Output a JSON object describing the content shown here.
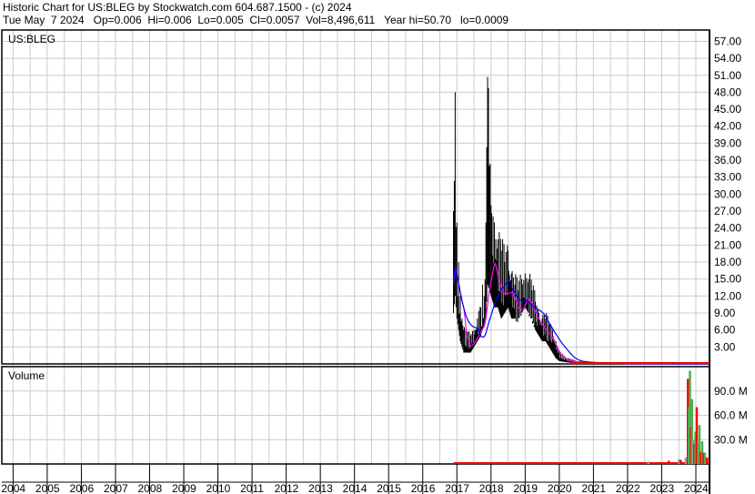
{
  "header": {
    "line1": "Historic Chart for US:BLEG by Stockwatch.com 604.687.1500 - (c) 2024",
    "line2": "Tue May  7 2024   Op=0.006  Hi=0.006  Lo=0.005  Cl=0.0057  Vol=8,496,611   Year hi=50.70   lo=0.0009"
  },
  "chart_data": [
    {
      "type": "line",
      "title": "US:BLEG",
      "ylim": [
        0,
        59
      ],
      "yticks": [
        "3.00",
        "6.00",
        "9.00",
        "12.00",
        "15.00",
        "18.00",
        "21.00",
        "24.00",
        "27.00",
        "30.00",
        "33.00",
        "36.00",
        "39.00",
        "42.00",
        "45.00",
        "48.00",
        "51.00",
        "54.00",
        "57.00"
      ],
      "xticks": [
        "2004",
        "2005",
        "2006",
        "2007",
        "2008",
        "2009",
        "2010",
        "2011",
        "2012",
        "2013",
        "2014",
        "2015",
        "2016",
        "2017",
        "2018",
        "2019",
        "2020",
        "2021",
        "2022",
        "2023",
        "2024"
      ],
      "xlim": [
        2003.67,
        2024.4
      ],
      "bars": [
        [
          2016.9,
          27,
          9,
          14
        ],
        [
          2016.95,
          48,
          12,
          20
        ],
        [
          2017.0,
          25,
          8,
          12
        ],
        [
          2017.05,
          18,
          6,
          10
        ],
        [
          2017.1,
          12,
          4,
          6
        ],
        [
          2017.15,
          8,
          3,
          4
        ],
        [
          2017.2,
          6,
          2,
          3
        ],
        [
          2017.3,
          5,
          2,
          3
        ],
        [
          2017.4,
          5,
          2,
          4
        ],
        [
          2017.5,
          6,
          3,
          5
        ],
        [
          2017.6,
          8,
          4,
          6
        ],
        [
          2017.7,
          10,
          5,
          7
        ],
        [
          2017.75,
          14,
          6,
          9
        ],
        [
          2017.8,
          12,
          7,
          8
        ],
        [
          2017.85,
          25,
          8,
          18
        ],
        [
          2017.9,
          50.7,
          14,
          22
        ],
        [
          2017.95,
          35,
          13,
          20
        ],
        [
          2018.0,
          28,
          12,
          17
        ],
        [
          2018.1,
          25,
          10,
          15
        ],
        [
          2018.2,
          22,
          10,
          13
        ],
        [
          2018.3,
          20,
          8,
          12
        ],
        [
          2018.4,
          18,
          9,
          13
        ],
        [
          2018.5,
          20,
          10,
          14
        ],
        [
          2018.6,
          16,
          8,
          11
        ],
        [
          2018.7,
          14,
          8,
          10
        ],
        [
          2018.8,
          13,
          8,
          10
        ],
        [
          2018.9,
          15,
          9,
          11
        ],
        [
          2019.0,
          16,
          10,
          13
        ],
        [
          2019.1,
          15,
          9,
          11
        ],
        [
          2019.2,
          13,
          8,
          10
        ],
        [
          2019.3,
          11,
          6,
          8
        ],
        [
          2019.4,
          9,
          5,
          7
        ],
        [
          2019.5,
          8,
          4,
          6
        ],
        [
          2019.6,
          8,
          4,
          6
        ],
        [
          2019.7,
          7,
          3,
          5
        ],
        [
          2019.8,
          6,
          2,
          3
        ],
        [
          2019.9,
          4,
          1,
          2
        ],
        [
          2020.0,
          2,
          0.5,
          1
        ],
        [
          2020.2,
          1,
          0.3,
          0.5
        ],
        [
          2020.5,
          0.5,
          0.2,
          0.3
        ],
        [
          2021.0,
          0.3,
          0.1,
          0.2
        ],
        [
          2021.5,
          0.2,
          0.05,
          0.1
        ],
        [
          2022.0,
          0.1,
          0.02,
          0.05
        ],
        [
          2023.0,
          0.05,
          0.01,
          0.02
        ],
        [
          2024.35,
          0.006,
          0.005,
          0.0057
        ]
      ],
      "series": [
        {
          "name": "MA short",
          "color": "#ff00ff",
          "period": 3
        },
        {
          "name": "MA long",
          "color": "#0000ff",
          "period": 8
        }
      ],
      "lastline_color": "#ff0000"
    },
    {
      "type": "bar",
      "title": "Volume",
      "ylim": [
        0,
        120
      ],
      "unit": "M",
      "yticks": [
        "30.0 M",
        "60.0 M",
        "90.0 M"
      ],
      "bars": [
        [
          2022.6,
          3,
          "#999999"
        ],
        [
          2022.7,
          2,
          "#ff0000"
        ],
        [
          2023.2,
          4,
          "#ff0000"
        ],
        [
          2023.5,
          6,
          "#999999"
        ],
        [
          2023.55,
          5,
          "#ff0000"
        ],
        [
          2023.7,
          8,
          "#999999"
        ],
        [
          2023.76,
          105,
          "#ff0000"
        ],
        [
          2023.79,
          70,
          "#4caf50"
        ],
        [
          2023.82,
          115,
          "#4caf50"
        ],
        [
          2023.85,
          45,
          "#ff0000"
        ],
        [
          2023.88,
          80,
          "#4caf50"
        ],
        [
          2023.91,
          30,
          "#999999"
        ],
        [
          2023.95,
          25,
          "#ff0000"
        ],
        [
          2023.98,
          40,
          "#4caf50"
        ],
        [
          2024.02,
          70,
          "#ff0000"
        ],
        [
          2024.06,
          25,
          "#4caf50"
        ],
        [
          2024.1,
          48,
          "#4caf50"
        ],
        [
          2024.14,
          15,
          "#ff0000"
        ],
        [
          2024.18,
          28,
          "#4caf50"
        ],
        [
          2024.22,
          14,
          "#ff0000"
        ],
        [
          2024.26,
          14,
          "#4caf50"
        ],
        [
          2024.32,
          8,
          "#ff0000"
        ]
      ],
      "baseline_color": "#ff0000"
    }
  ]
}
